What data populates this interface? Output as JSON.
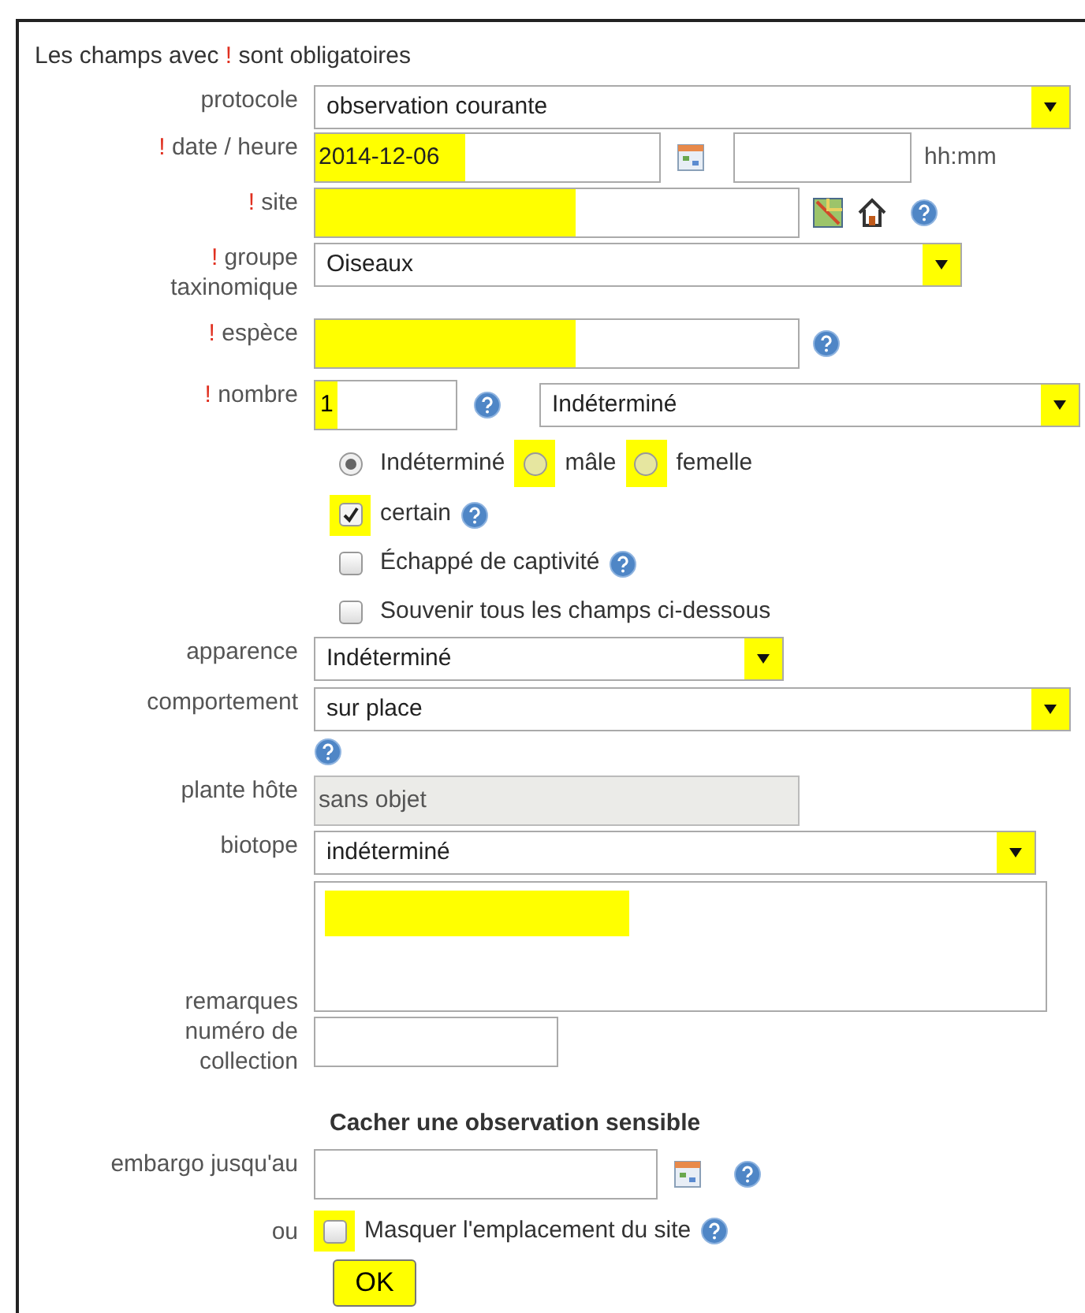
{
  "notice": {
    "before": "Les champs avec",
    "mark": "!",
    "after": "sont obligatoires"
  },
  "rows": [
    {
      "kind": "select",
      "label": "protocole",
      "value": "observation courante",
      "highlighted": true
    },
    {
      "kind": "text",
      "label": "date / heure",
      "required_mark": "!",
      "value": "2014-12-06",
      "highlighted": true,
      "calendar": true,
      "time_hint": "hh:mm"
    },
    {
      "kind": "text",
      "label": "site",
      "required_mark": "!",
      "highlighted": true,
      "map": true,
      "home": true,
      "help": true
    },
    {
      "kind": "select",
      "label": "groupe taxinomique",
      "required_mark": "!",
      "value": "Oiseaux",
      "highlighted": true
    },
    {
      "kind": "text",
      "label": "espèce",
      "required_mark": "!",
      "highlighted": true,
      "help": true
    },
    {
      "kind": "nombre",
      "label": "nombre",
      "required_mark": "!",
      "value": "1",
      "highlighted": true,
      "help": true,
      "select_value": "Indéterminé",
      "select_highlighted": true
    },
    {
      "kind": "radios",
      "options": [
        {
          "label": "Indéterminé",
          "selected": true,
          "highlighted": false
        },
        {
          "label": "mâle",
          "selected": false,
          "highlighted": true
        },
        {
          "label": "femelle",
          "selected": false,
          "highlighted": true
        }
      ]
    },
    {
      "kind": "checkbox",
      "text": "certain",
      "checked": true,
      "highlighted": true,
      "help": true
    },
    {
      "kind": "checkbox",
      "text": "Échappé de captivité",
      "checked": false,
      "highlighted": false,
      "help": true
    },
    {
      "kind": "checkbox",
      "text": "Souvenir tous les champs ci-dessous",
      "checked": false,
      "highlighted": false
    },
    {
      "kind": "select",
      "label": "apparence",
      "value": "Indéterminé",
      "highlighted": true
    },
    {
      "kind": "select",
      "label": "comportement",
      "value": "sur place",
      "highlighted": true,
      "help": true
    },
    {
      "kind": "text",
      "label": "plante hôte",
      "value": "sans objet",
      "disabled": true
    },
    {
      "kind": "select",
      "label": "biotope",
      "value": "indéterminé",
      "highlighted": true
    },
    {
      "kind": "textarea",
      "label": "remarques",
      "highlighted": true
    },
    {
      "kind": "text",
      "label": "numéro de collection"
    },
    {
      "kind": "heading",
      "text": "Cacher une observation sensible"
    },
    {
      "kind": "text",
      "label": "embargo jusqu'au",
      "calendar": true,
      "help": true
    },
    {
      "kind": "checkbox",
      "label": "ou",
      "text": "Masquer l'emplacement du site",
      "checked": false,
      "highlighted": true,
      "help": true
    },
    {
      "kind": "button",
      "text": "OK",
      "highlighted": true
    }
  ]
}
